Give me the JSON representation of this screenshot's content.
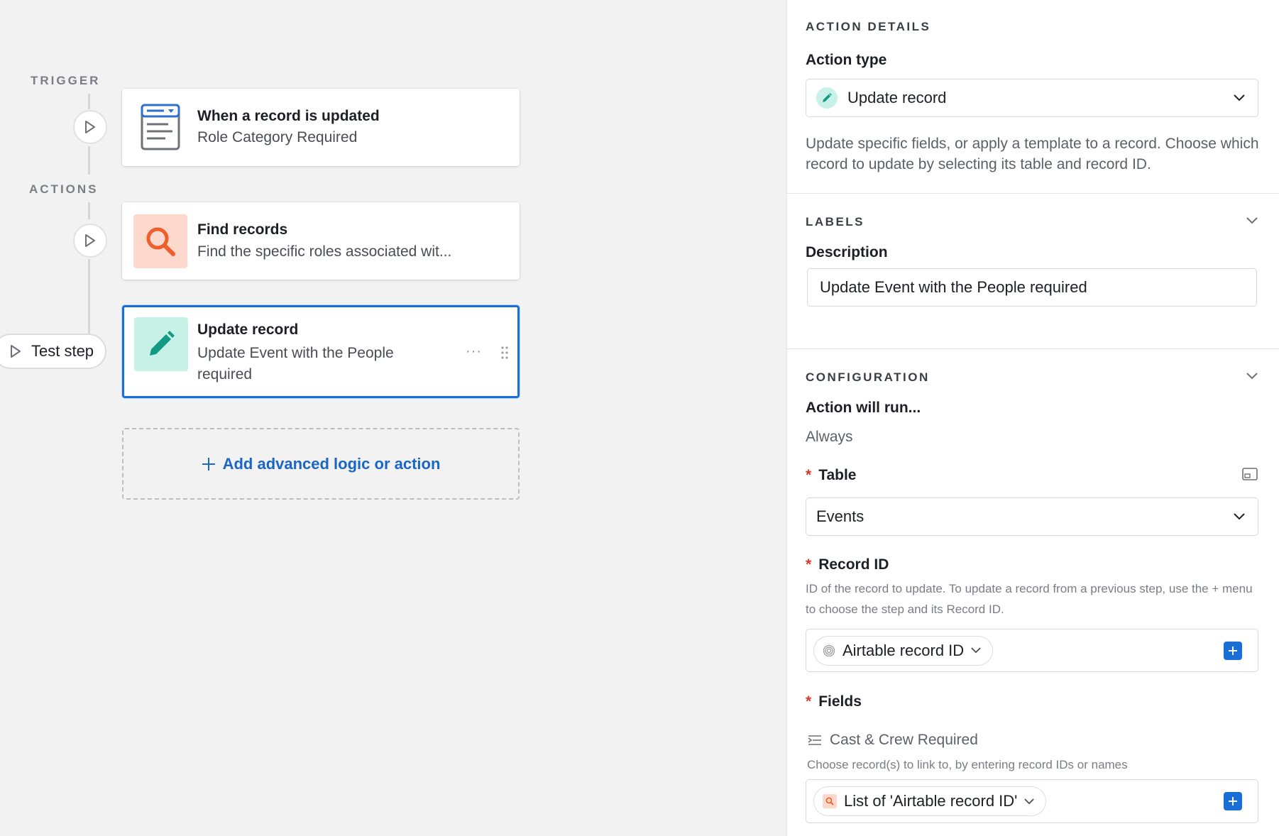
{
  "canvas": {
    "trigger_label": "TRIGGER",
    "actions_label": "ACTIONS",
    "trigger_card": {
      "title": "When a record is updated",
      "subtitle": "Role Category Required"
    },
    "find_card": {
      "title": "Find records",
      "subtitle": "Find the specific roles associated wit..."
    },
    "update_card": {
      "title": "Update record",
      "subtitle_line1": "Update Event with the People",
      "subtitle_line2": "required",
      "more": "···"
    },
    "test_step": "Test step",
    "add_action": "Add advanced logic or action"
  },
  "panel": {
    "action_details_heading": "ACTION DETAILS",
    "action_type_label": "Action type",
    "action_type_value": "Update record",
    "action_type_help": "Update specific fields, or apply a template to a record. Choose which record to update by selecting its table and record ID.",
    "labels_heading": "LABELS",
    "description_label": "Description",
    "description_value": "Update Event with the People required",
    "configuration_heading": "CONFIGURATION",
    "action_will_run_label": "Action will run...",
    "action_will_run_value": "Always",
    "required_mark": "*",
    "table_label": "Table",
    "table_value": "Events",
    "record_id_label": "Record ID",
    "record_id_help": "ID of the record to update. To update a record from a previous step, use the + menu to choose the step and its Record ID.",
    "record_id_token": "Airtable record ID",
    "fields_label": "Fields",
    "field_name": "Cast & Crew Required",
    "field_help": "Choose record(s) to link to, by entering record IDs or names",
    "field_token": "List of 'Airtable record ID'"
  },
  "colors": {
    "accent": "#1a6fd6",
    "link": "#1a66c4",
    "find_icon_bg": "#fcd9cc",
    "find_icon": "#ee5f2d",
    "update_icon_bg": "#c8f1e7",
    "update_icon": "#139a84",
    "required": "#d93b2b"
  }
}
